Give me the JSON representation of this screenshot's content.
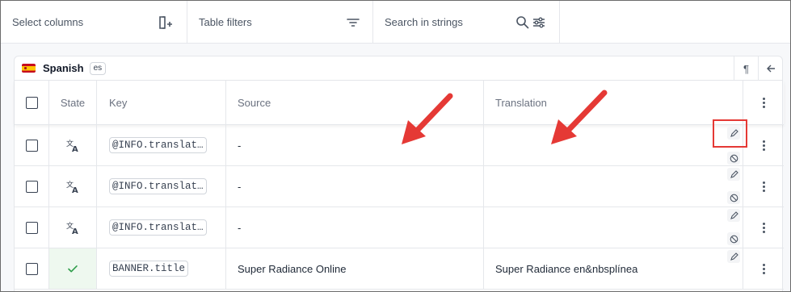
{
  "toolbar": {
    "select_columns": "Select columns",
    "table_filters": "Table filters",
    "search_placeholder": "Search in strings"
  },
  "language": {
    "name": "Spanish",
    "code": "es",
    "icons": [
      "pilcrow-icon",
      "arrow-left-icon"
    ]
  },
  "table": {
    "headers": {
      "state": "State",
      "key": "Key",
      "source": "Source",
      "translation": "Translation"
    },
    "rows": [
      {
        "state": "translate-icon",
        "key": "@INFO.translat…",
        "source": "-",
        "translation": ""
      },
      {
        "state": "translate-icon",
        "key": "@INFO.translat…",
        "source": "-",
        "translation": ""
      },
      {
        "state": "translate-icon",
        "key": "@INFO.translat…",
        "source": "-",
        "translation": ""
      },
      {
        "state": "check-icon",
        "key": "BANNER.title",
        "source": "Super Radiance Online",
        "translation": "Super Radiance en&nbsplínea"
      }
    ]
  },
  "colors": {
    "accent_red": "#e53935",
    "approved_green": "#2e9d4a"
  }
}
